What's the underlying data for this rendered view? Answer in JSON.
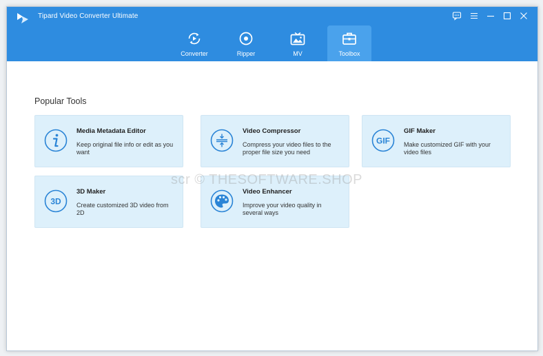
{
  "app": {
    "title": "Tipard Video Converter Ultimate",
    "accent": "#2e8ce0"
  },
  "nav": {
    "tabs": [
      {
        "label": "Converter",
        "icon": "converter-icon",
        "active": false
      },
      {
        "label": "Ripper",
        "icon": "ripper-icon",
        "active": false
      },
      {
        "label": "MV",
        "icon": "mv-icon",
        "active": false
      },
      {
        "label": "Toolbox",
        "icon": "toolbox-icon",
        "active": true
      }
    ]
  },
  "main": {
    "section_title": "Popular Tools",
    "tools": [
      {
        "name": "Media Metadata Editor",
        "desc": "Keep original file info or edit as you want",
        "icon": "info-icon"
      },
      {
        "name": "Video Compressor",
        "desc": "Compress your video files to the proper file size you need",
        "icon": "compress-icon"
      },
      {
        "name": "GIF Maker",
        "desc": "Make customized GIF with your video files",
        "icon": "gif-icon",
        "icon_text": "GIF"
      },
      {
        "name": "3D Maker",
        "desc": "Create customized 3D video from 2D",
        "icon": "3d-icon",
        "icon_text": "3D"
      },
      {
        "name": "Video Enhancer",
        "desc": "Improve your video quality in several ways",
        "icon": "palette-icon"
      }
    ]
  },
  "watermark": "scr © THESOFTWARE.SHOP"
}
